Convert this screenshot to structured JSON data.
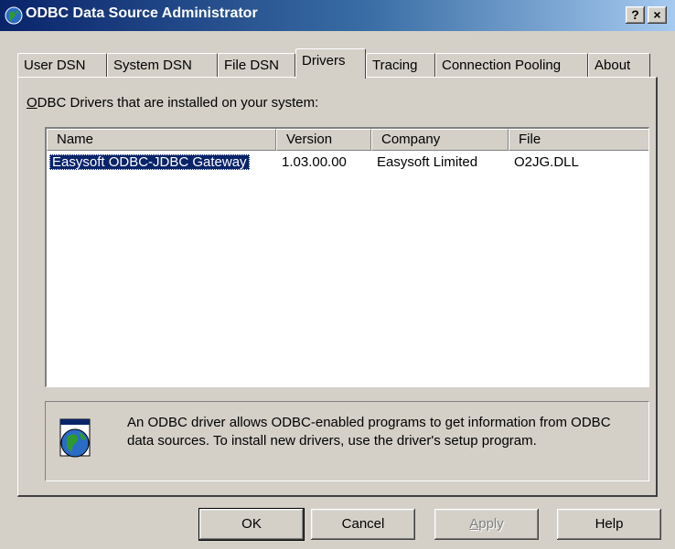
{
  "window": {
    "title": "ODBC Data Source Administrator",
    "help_button": "?",
    "close_button": "×",
    "icon": "odbc-globe-icon"
  },
  "tabs": [
    {
      "label": "User DSN",
      "active": false
    },
    {
      "label": "System DSN",
      "active": false
    },
    {
      "label": "File DSN",
      "active": false
    },
    {
      "label": "Drivers",
      "active": true
    },
    {
      "label": "Tracing",
      "active": false
    },
    {
      "label": "Connection Pooling",
      "active": false
    },
    {
      "label": "About",
      "active": false
    }
  ],
  "drivers": {
    "caption_accel": "O",
    "caption_rest": "DBC Drivers that are installed on your system:",
    "columns": [
      "Name",
      "Version",
      "Company",
      "File"
    ],
    "rows": [
      {
        "name": "Easysoft ODBC-JDBC Gateway",
        "version": "1.03.00.00",
        "company": "Easysoft Limited",
        "file": "O2JG.DLL",
        "selected": true
      }
    ]
  },
  "info": {
    "icon": "odbc-driver-icon",
    "text": "An ODBC driver allows ODBC-enabled programs to get information from ODBC data sources.  To install new drivers, use the driver's setup program."
  },
  "buttons": {
    "ok": "OK",
    "cancel": "Cancel",
    "apply_accel": "A",
    "apply_rest": "pply",
    "help": "Help"
  },
  "colors": {
    "titlebar_start": "#0a246a",
    "titlebar_end": "#a6caf0",
    "face": "#d4d0c8",
    "selection": "#0a246a"
  }
}
